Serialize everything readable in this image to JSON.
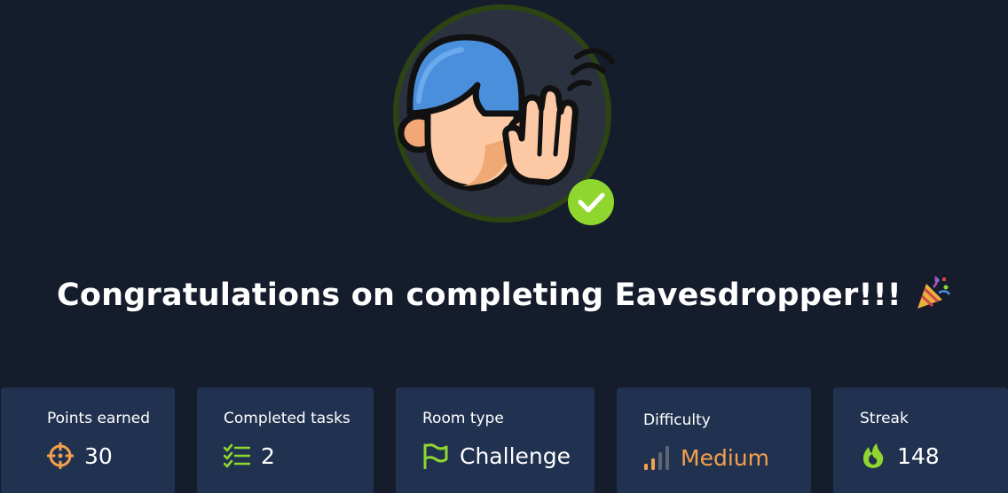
{
  "headline": {
    "text": "Congratulations on completing Eavesdropper!!!",
    "emoji_icon": "party-popper-icon"
  },
  "avatar": {
    "icon": "eavesdropper-avatar-icon",
    "badge_icon": "check-badge-icon",
    "ring_color": "#2c4312",
    "badge_color": "#8fd72f"
  },
  "stats": [
    {
      "label": "Points earned",
      "value": "30",
      "icon": "crosshair-icon",
      "icon_color": "#f5a04a"
    },
    {
      "label": "Completed tasks",
      "value": "2",
      "icon": "task-list-icon",
      "icon_color": "#8fd72f"
    },
    {
      "label": "Room type",
      "value": "Challenge",
      "icon": "flag-icon",
      "icon_color": "#8fd72f"
    },
    {
      "label": "Difficulty",
      "value": "Medium",
      "icon": "signal-bars-icon",
      "icon_color": "#f5a04a"
    },
    {
      "label": "Streak",
      "value": "148",
      "icon": "fire-icon",
      "icon_color": "#8fd72f"
    }
  ]
}
